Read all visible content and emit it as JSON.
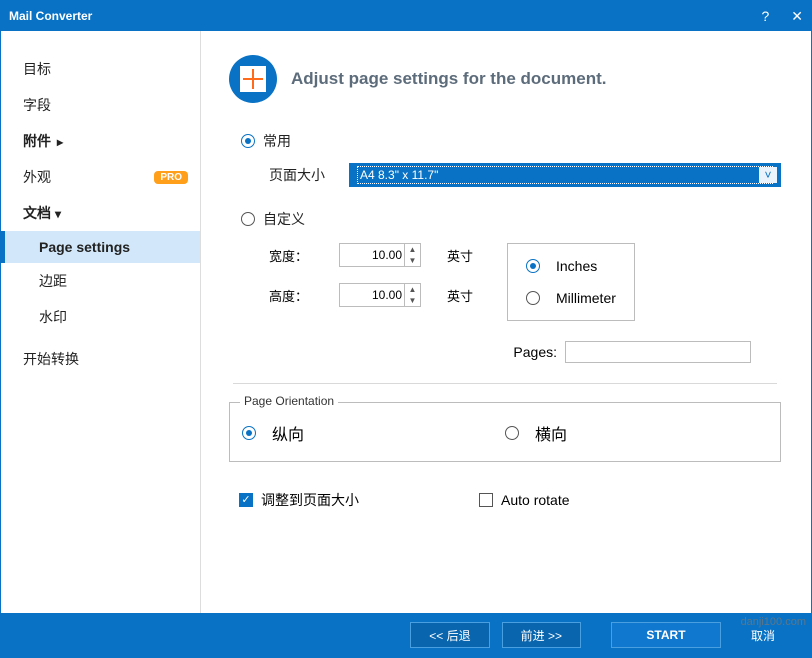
{
  "window": {
    "title": "Mail Converter"
  },
  "sidebar": {
    "pro": "PRO",
    "items": [
      {
        "label": "目标"
      },
      {
        "label": "字段"
      },
      {
        "label": "附件"
      },
      {
        "label": "外观"
      },
      {
        "label": "文档"
      }
    ],
    "subitems": [
      {
        "label": "Page settings"
      },
      {
        "label": "边距"
      },
      {
        "label": "水印"
      }
    ],
    "start": "开始转换"
  },
  "main": {
    "heading": "Adjust page settings for the document.",
    "common": {
      "label": "常用",
      "sizeLabel": "页面大小",
      "sizeValue": "A4 8.3\" x 11.7\""
    },
    "custom": {
      "label": "自定义",
      "widthLabel": "宽度：",
      "widthValue": "10.00",
      "heightLabel": "高度：",
      "heightValue": "10.00",
      "unit": "英寸"
    },
    "units": {
      "inches": "Inches",
      "mm": "Millimeter"
    },
    "pagesLabel": "Pages:",
    "pagesValue": "",
    "orient": {
      "legend": "Page Orientation",
      "portrait": "纵向",
      "landscape": "横向"
    },
    "fit": "调整到页面大小",
    "autorotate": "Auto rotate"
  },
  "footer": {
    "back": "<<  后退",
    "next": "前进  >>",
    "start": "START",
    "cancel": "取消"
  },
  "watermark": "danji100.com"
}
